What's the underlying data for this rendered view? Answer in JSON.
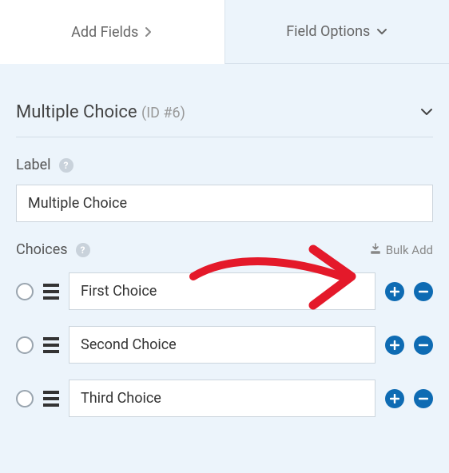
{
  "tabs": {
    "add_fields": "Add Fields",
    "field_options": "Field Options"
  },
  "panel": {
    "title": "Multiple Choice",
    "id_label": "(ID #6)"
  },
  "label_section": {
    "label": "Label",
    "value": "Multiple Choice"
  },
  "choices_section": {
    "label": "Choices",
    "bulk_add": "Bulk Add",
    "items": [
      {
        "value": "First Choice"
      },
      {
        "value": "Second Choice"
      },
      {
        "value": "Third Choice"
      }
    ]
  }
}
